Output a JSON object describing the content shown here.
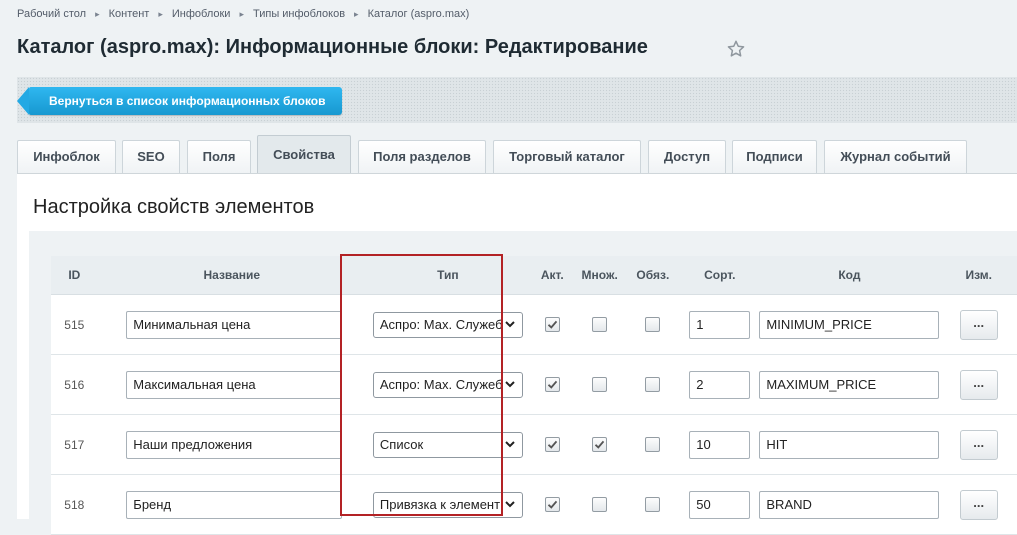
{
  "breadcrumb": [
    "Рабочий стол",
    "Контент",
    "Инфоблоки",
    "Типы инфоблоков",
    "Каталог (aspro.max)"
  ],
  "page_title": "Каталог (aspro.max): Информационные блоки: Редактирование",
  "back_button": "Вернуться в список информационных блоков",
  "tabs": [
    "Инфоблок",
    "SEO",
    "Поля",
    "Свойства",
    "Поля разделов",
    "Торговый каталог",
    "Доступ",
    "Подписи",
    "Журнал событий"
  ],
  "active_tab": "Свойства",
  "section_title": "Настройка свойств элементов",
  "table": {
    "headers": [
      "ID",
      "Название",
      "Тип",
      "Акт.",
      "Множ.",
      "Обяз.",
      "Сорт.",
      "Код",
      "Изм."
    ],
    "more_label": "...",
    "rows": [
      {
        "id": "515",
        "name": "Минимальная цена",
        "type": "Аспро: Мах. Служеб",
        "active": true,
        "multiple": false,
        "required": false,
        "sort": "1",
        "code": "MINIMUM_PRICE"
      },
      {
        "id": "516",
        "name": "Максимальная цена",
        "type": "Аспро: Мах. Служеб",
        "active": true,
        "multiple": false,
        "required": false,
        "sort": "2",
        "code": "MAXIMUM_PRICE"
      },
      {
        "id": "517",
        "name": "Наши предложения",
        "type": "Список",
        "active": true,
        "multiple": true,
        "required": false,
        "sort": "10",
        "code": "HIT"
      },
      {
        "id": "518",
        "name": "Бренд",
        "type": "Привязка к элемент",
        "active": true,
        "multiple": false,
        "required": false,
        "sort": "50",
        "code": "BRAND"
      }
    ]
  },
  "colors": {
    "accent": "#2fb7f0",
    "highlight": "#b32225"
  }
}
